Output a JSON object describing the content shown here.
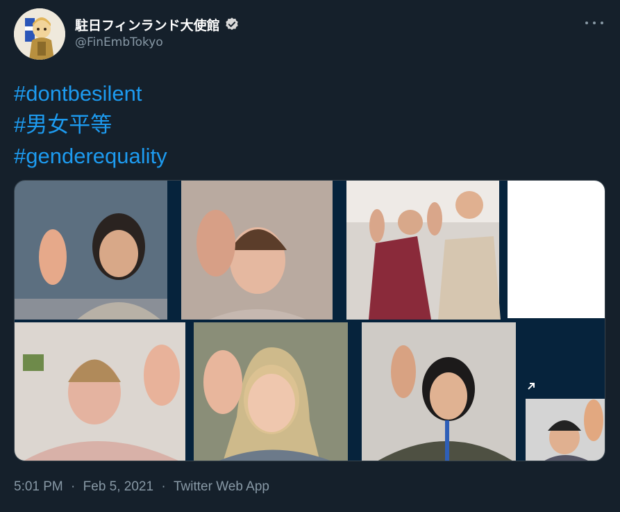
{
  "tweet": {
    "author": {
      "display_name": "駐日フィンランド大使館",
      "handle": "@FinEmbTokyo",
      "verified": true,
      "verified_icon": "verified-badge-icon"
    },
    "more_icon": "more-dots-icon",
    "hashtags": [
      "#dontbesilent",
      "#男女平等",
      "#genderequality"
    ],
    "media": {
      "type": "video-call-screenshot",
      "participants_count": 9
    },
    "meta": {
      "time": "5:01 PM",
      "date": "Feb 5, 2021",
      "source": "Twitter Web App",
      "separator": "·"
    }
  },
  "colors": {
    "background": "#15202b",
    "hashtag": "#1d9bf0",
    "secondary_text": "#8899a6",
    "primary_text": "#ffffff"
  }
}
